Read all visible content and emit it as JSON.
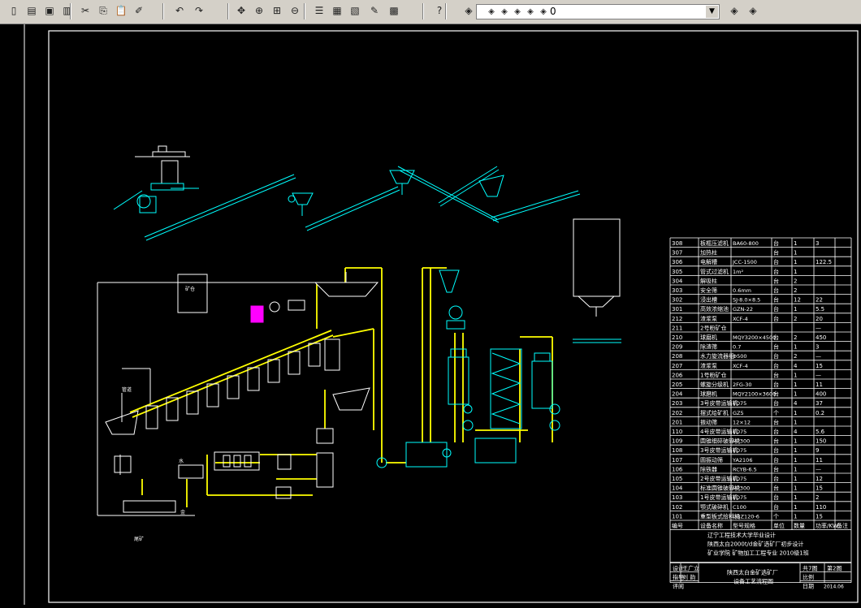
{
  "toolbar": {
    "buttons": [
      "new-icon",
      "open-icon",
      "save-icon",
      "print-icon",
      "cut-icon",
      "copy-icon",
      "paste-icon",
      "match-properties-icon",
      "undo-icon",
      "redo-icon",
      "pan-icon",
      "zoom-realtime-icon",
      "zoom-window-icon",
      "zoom-previous-icon",
      "properties-icon",
      "design-center-icon",
      "tool-palettes-icon",
      "markup-icon",
      "calculator-icon",
      "help-icon"
    ],
    "layer_value": "0",
    "icon_glyphs": {
      "help": "?"
    }
  },
  "labels": {
    "mineral_bin": "矿仓",
    "pipe_label": "管道",
    "water_label": "水",
    "gold_label": "金",
    "tail_label": "尾矿"
  },
  "table": {
    "rows": [
      [
        "308",
        "板框压滤机",
        "BA60-800",
        "台",
        "1",
        "3",
        ""
      ],
      [
        "307",
        "加热柱",
        "",
        "台",
        "1",
        "",
        ""
      ],
      [
        "306",
        "电解槽",
        "JCC-1500",
        "台",
        "1",
        "122.5",
        ""
      ],
      [
        "305",
        "管式过滤机",
        "1m²",
        "台",
        "1",
        "",
        ""
      ],
      [
        "304",
        "解吸柱",
        "",
        "台",
        "2",
        "",
        ""
      ],
      [
        "303",
        "安全筛",
        "0.6mm",
        "台",
        "2",
        "",
        ""
      ],
      [
        "302",
        "浸出槽",
        "SJ-8.0×8.5",
        "台",
        "12",
        "22",
        ""
      ],
      [
        "301",
        "高效浓缩池",
        "GZN-22",
        "台",
        "1",
        "5.5",
        ""
      ],
      [
        "212",
        "渣浆泵",
        "XCF-4",
        "台",
        "2",
        "20",
        ""
      ],
      [
        "211",
        "2号粉矿仓",
        "",
        "",
        "",
        "—",
        ""
      ],
      [
        "210",
        "球磨机",
        "MQY3200×4500",
        "台",
        "2",
        "450",
        ""
      ],
      [
        "209",
        "除渣筛",
        "0.7",
        "台",
        "1",
        "3",
        ""
      ],
      [
        "208",
        "水力旋流器组",
        "Φ500",
        "台",
        "2",
        "—",
        ""
      ],
      [
        "207",
        "渣浆泵",
        "XCF-4",
        "台",
        "4",
        "15",
        ""
      ],
      [
        "206",
        "1号粉矿仓",
        "",
        "台",
        "1",
        "—",
        ""
      ],
      [
        "205",
        "螺旋分级机",
        "2FG-30",
        "台",
        "1",
        "11",
        ""
      ],
      [
        "204",
        "球磨机",
        "MQY2100×3600",
        "台",
        "1",
        "400",
        ""
      ],
      [
        "203",
        "3号皮带运输机",
        "TD75",
        "台",
        "4",
        "37",
        ""
      ],
      [
        "202",
        "摆式给矿机",
        "GZ5",
        "个",
        "1",
        "0.2",
        ""
      ],
      [
        "201",
        "振动筛",
        "12×12",
        "台",
        "1",
        "",
        ""
      ],
      [
        "110",
        "4号皮带运输机",
        "TD75",
        "台",
        "4",
        "5.6",
        ""
      ],
      [
        "109",
        "圆锥细碎破碎机",
        "HP300",
        "台",
        "1",
        "150",
        ""
      ],
      [
        "108",
        "3号皮带运输机",
        "TD75",
        "台",
        "1",
        "9",
        ""
      ],
      [
        "107",
        "圆振动筛",
        "YA2106",
        "台",
        "1",
        "11",
        ""
      ],
      [
        "106",
        "除铁器",
        "RCYB-6.5",
        "台",
        "1",
        "—",
        ""
      ],
      [
        "105",
        "2号皮带运输机",
        "TD75",
        "台",
        "1",
        "12",
        ""
      ],
      [
        "104",
        "标准圆锥破碎机",
        "HP300",
        "台",
        "1",
        "15",
        ""
      ],
      [
        "103",
        "1号皮带运输机",
        "TD75",
        "台",
        "1",
        "2",
        ""
      ],
      [
        "102",
        "颚式破碎机",
        "C100",
        "台",
        "1",
        "110",
        ""
      ],
      [
        "101",
        "重型板式给料机",
        "GBZ120-6",
        "个",
        "1",
        "15",
        ""
      ]
    ],
    "header": [
      "编号",
      "设备名称",
      "型号规格",
      "单位",
      "数量",
      "功率/KW",
      "备注"
    ],
    "title_lines": [
      "辽宁工程技术大学毕业设计",
      "陕西太白2000t/d金矿选矿厂初步设计",
      "矿业学院  矿物加工工程专业  2010级1班"
    ],
    "sign": {
      "design_label": "设计",
      "design_name": "王广立",
      "guide_label": "指导",
      "guide_name": "刘  韵",
      "review_label": "评阅",
      "project": "陕西太白金矿选矿厂",
      "drawing": "设备工艺流程图",
      "total": "共7图",
      "num": "第2图",
      "scale": "比例",
      "date_label": "日期",
      "date": "2014.06"
    }
  }
}
